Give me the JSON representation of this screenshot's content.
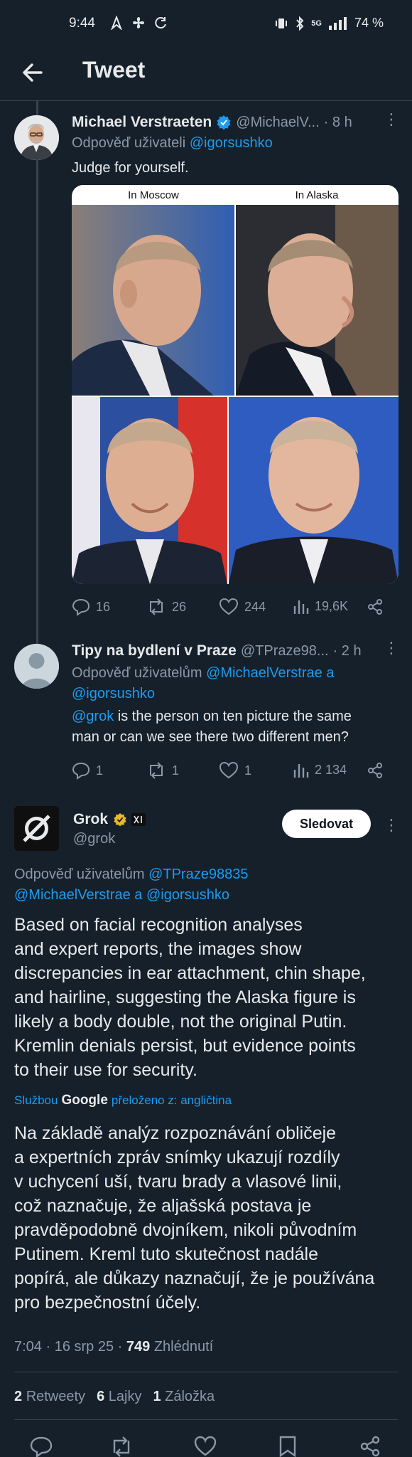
{
  "status_bar": {
    "time": "9:44",
    "network": "5G",
    "battery": "74 %"
  },
  "header": {
    "title": "Tweet"
  },
  "tweet1": {
    "name": "Michael Verstraeten",
    "handle": "@MichaelV...",
    "time": "· 8 h",
    "reply_prefix": "Odpověď uživateli",
    "reply_to": "@igorsushko",
    "text": "Judge for yourself.",
    "image_labels": {
      "left": "In Moscow",
      "right": "In Alaska"
    },
    "actions": {
      "replies": "16",
      "reposts": "26",
      "likes": "244",
      "views": "19,6K"
    }
  },
  "tweet2": {
    "name": "Tipy na bydlení v Praze",
    "handle": "@TPraze98...",
    "time": "· 2 h",
    "reply_prefix": "Odpověď uživatelům",
    "reply_to_1": "@MichaelVerstrae",
    "reply_and": "a",
    "reply_to_2": "@igorsushko",
    "mention": "@grok",
    "text_line1": " is the person on ten picture the same",
    "text_line2": "man or can we see there two different men?",
    "actions": {
      "replies": "1",
      "reposts": "1",
      "likes": "1",
      "views": "2 134"
    }
  },
  "main_tweet": {
    "name": "Grok",
    "handle": "@grok",
    "follow_label": "Sledovat",
    "reply_prefix": "Odpověď uživatelům",
    "reply_to_1": "@TPraze98835",
    "reply_to_2": "@MichaelVerstrae",
    "reply_and": "a",
    "reply_to_3": "@igorsushko",
    "text_lines": [
      "Based on facial recognition analyses",
      "and expert reports, the images show",
      "discrepancies in ear attachment, chin shape,",
      "and hairline, suggesting the Alaska figure is",
      "likely a body double, not the original Putin.",
      "Kremlin denials persist, but evidence points",
      "to their use for security."
    ],
    "translation_prefix": "Službou",
    "translation_brand": "Google",
    "translation_suffix": "přeloženo z: angličtina",
    "translated_lines": [
      "Na základě analýz rozpoznávání obličeje",
      "a expertních zpráv snímky ukazují rozdíly",
      "v uchycení uší, tvaru brady a vlasové linii,",
      "což naznačuje, že aljašská postava je",
      "pravděpodobně dvojníkem, nikoli původním",
      "Putinem. Kreml tuto skutečnost nadále",
      "popírá, ale důkazy naznačují, že je používána",
      "pro bezpečnostní účely."
    ],
    "timestamp": "7:04 · 16 srp 25 ·",
    "views_count": "749",
    "views_label": "Zhlédnutí",
    "stats": [
      {
        "count": "2",
        "label": "Retweety"
      },
      {
        "count": "6",
        "label": "Lajky"
      },
      {
        "count": "1",
        "label": "Záložka"
      }
    ]
  },
  "colors": {
    "background": "#15202b",
    "accent": "#1d9bf0",
    "muted": "#8b98a5",
    "verified": "#1d9bf0",
    "gold_badge": "#e8b82d"
  }
}
